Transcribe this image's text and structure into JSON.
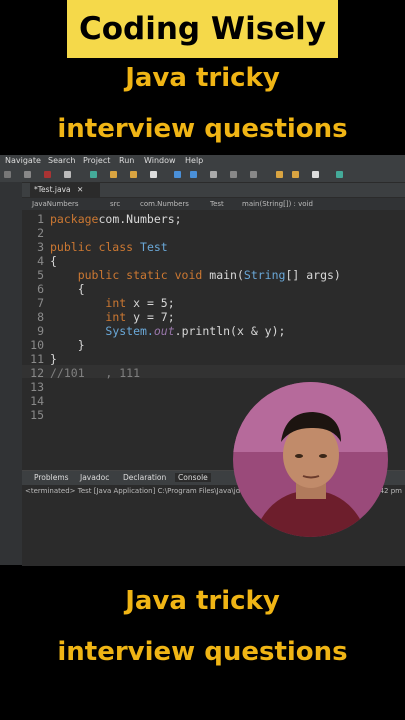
{
  "overlay": {
    "banner_title": "Coding Wisely",
    "top_line1": "Java tricky",
    "top_line2": "interview questions",
    "bottom_line1": "Java tricky",
    "bottom_line2": "interview questions"
  },
  "menu": [
    "Navigate",
    "Search",
    "Project",
    "Run",
    "Window",
    "Help"
  ],
  "editor": {
    "tab_label": "*Test.java",
    "tab_close": "✕",
    "breadcrumb": [
      "JavaNumbers",
      "src",
      "com.Numbers",
      "Test",
      "main(String[]) : void"
    ],
    "line_numbers": [
      "1",
      "2",
      "3",
      "4",
      "5",
      "6",
      "7",
      "8",
      "9",
      "10",
      "11",
      "12",
      "13",
      "14",
      "15"
    ]
  },
  "bottom_panel": {
    "tabs": [
      "Problems",
      "Javadoc",
      "Declaration",
      "Console"
    ],
    "console_status": "<terminated> Test [Java Application] C:\\Program Files\\Java\\jdk",
    "time_fragment": "42 pm"
  },
  "colors": {
    "banner": "#f5d94a",
    "caption": "#f0b515",
    "editor_bg": "#2b2b2b"
  }
}
